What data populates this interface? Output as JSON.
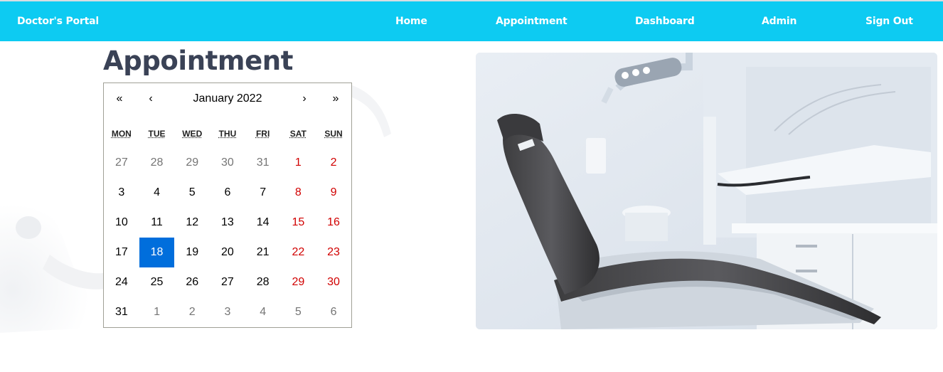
{
  "navbar": {
    "brand": "Doctor's Portal",
    "links": [
      {
        "label": "Home"
      },
      {
        "label": "Appointment"
      },
      {
        "label": "Dashboard"
      },
      {
        "label": "Admin"
      },
      {
        "label": "Sign Out"
      }
    ],
    "bg_color": "#0dcbf2"
  },
  "page": {
    "title": "Appointment"
  },
  "calendar": {
    "prev2": "«",
    "prev": "‹",
    "label": "January 2022",
    "next": "›",
    "next2": "»",
    "weekdays": [
      "MON",
      "TUE",
      "WED",
      "THU",
      "FRI",
      "SAT",
      "SUN"
    ],
    "selected": "18",
    "selected_color": "#006edc",
    "weekend_color": "#d10000",
    "weeks": [
      [
        "27",
        "28",
        "29",
        "30",
        "31",
        "1",
        "2"
      ],
      [
        "3",
        "4",
        "5",
        "6",
        "7",
        "8",
        "9"
      ],
      [
        "10",
        "11",
        "12",
        "13",
        "14",
        "15",
        "16"
      ],
      [
        "17",
        "18",
        "19",
        "20",
        "21",
        "22",
        "23"
      ],
      [
        "24",
        "25",
        "26",
        "27",
        "28",
        "29",
        "30"
      ],
      [
        "31",
        "1",
        "2",
        "3",
        "4",
        "5",
        "6"
      ]
    ],
    "neighbor_days": [
      [
        0,
        0
      ],
      [
        0,
        1
      ],
      [
        0,
        2
      ],
      [
        0,
        3
      ],
      [
        0,
        4
      ],
      [
        5,
        1
      ],
      [
        5,
        2
      ],
      [
        5,
        3
      ],
      [
        5,
        4
      ],
      [
        5,
        5
      ],
      [
        5,
        6
      ]
    ]
  },
  "hero_image": {
    "icon": "dental-chair-photo"
  }
}
